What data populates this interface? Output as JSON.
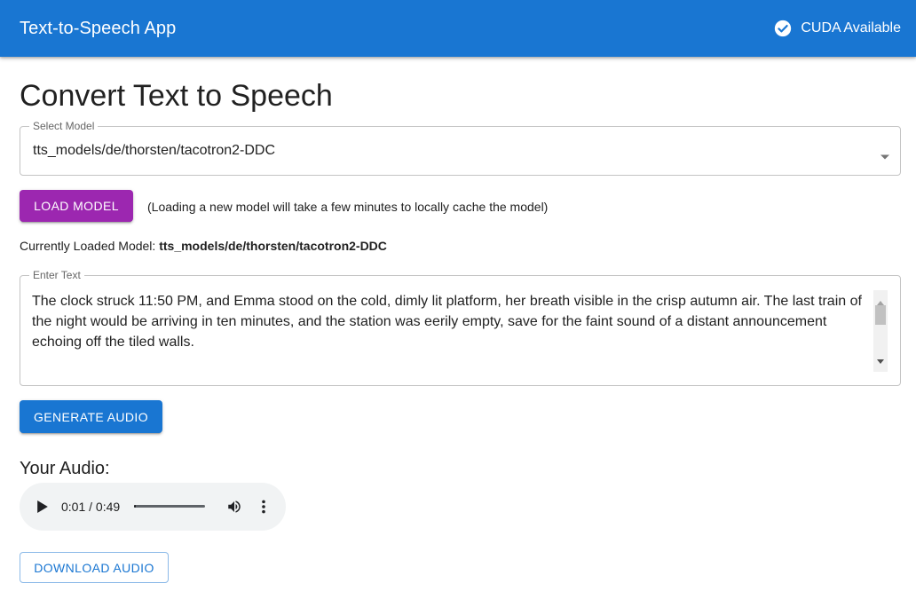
{
  "appbar": {
    "title": "Text-to-Speech App",
    "cuda_label": "CUDA Available",
    "cuda_icon": "check-circle-icon",
    "color": "#1976d2"
  },
  "main": {
    "title": "Convert Text to Speech",
    "model_select": {
      "label": "Select Model",
      "value": "tts_models/de/thorsten/tacotron2-DDC",
      "icon": "dropdown-arrow-icon"
    },
    "load_button": {
      "label": "LOAD MODEL",
      "color": "#9c27b0"
    },
    "load_note": "(Loading a new model will take a few minutes to locally cache the model)",
    "loaded": {
      "prefix": "Currently Loaded Model:",
      "model": "tts_models/de/thorsten/tacotron2-DDC"
    },
    "text_input": {
      "label": "Enter Text",
      "value": "The clock struck 11:50 PM, and Emma stood on the cold, dimly lit platform, her breath visible in the crisp autumn air. The last train of the night would be arriving in ten minutes, and the station was eerily empty, save for the faint sound of a distant announcement echoing off the tiled walls."
    },
    "generate_button": {
      "label": "GENERATE AUDIO",
      "color": "#1976d2"
    },
    "audio": {
      "heading": "Your Audio:",
      "time": "0:01 / 0:49",
      "progress": 0.02,
      "icons": [
        "play-icon",
        "volume-icon",
        "more-vert-icon"
      ]
    },
    "download_button": {
      "label": "DOWNLOAD AUDIO"
    }
  }
}
